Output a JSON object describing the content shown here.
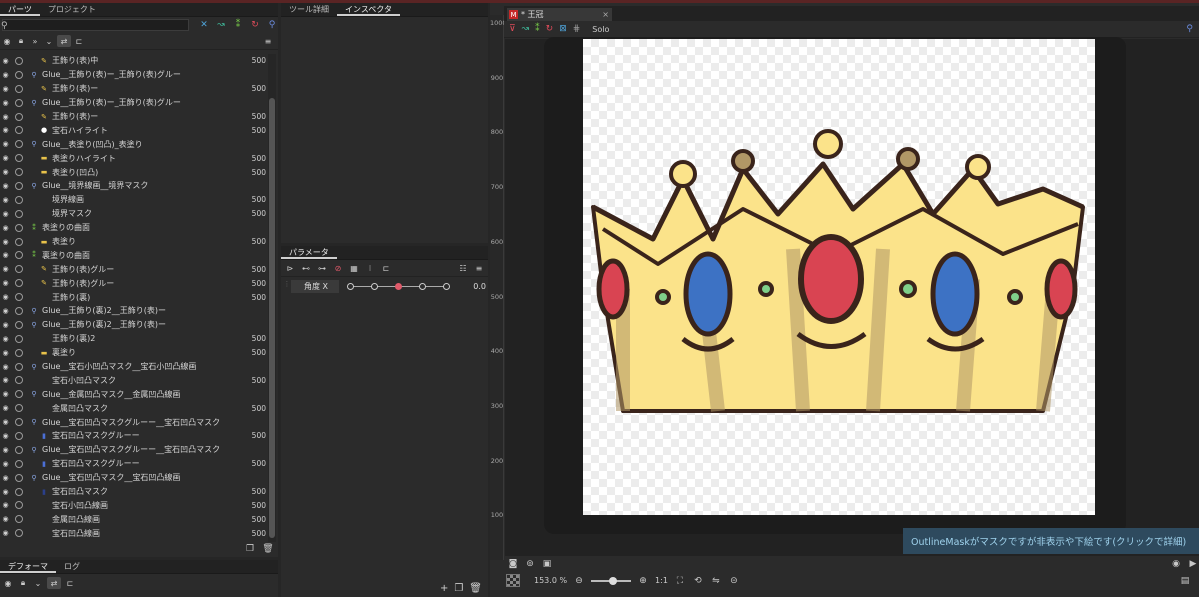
{
  "left_panel": {
    "tabs": [
      "パーツ",
      "プロジェクト"
    ],
    "search": {
      "value": ""
    },
    "layers": [
      {
        "name": "王飾り(表)中",
        "value": "500",
        "indent": 1,
        "type": "art"
      },
      {
        "name": "Glue__王飾り(表)ー_王飾り(表)グルー",
        "value": "",
        "indent": 0,
        "type": "glue"
      },
      {
        "name": "王飾り(表)ー",
        "value": "500",
        "indent": 1,
        "type": "art"
      },
      {
        "name": "Glue__王飾り(表)ー_王飾り(表)グルー",
        "value": "",
        "indent": 0,
        "type": "glue"
      },
      {
        "name": "王飾り(表)ー",
        "value": "500",
        "indent": 1,
        "type": "art"
      },
      {
        "name": "宝石ハイライト",
        "value": "500",
        "indent": 1,
        "type": "white"
      },
      {
        "name": "Glue__表塗り(凹凸)_表塗り",
        "value": "",
        "indent": 0,
        "type": "glue"
      },
      {
        "name": "表塗りハイライト",
        "value": "500",
        "indent": 1,
        "type": "mesh"
      },
      {
        "name": "表塗り(凹凸)",
        "value": "500",
        "indent": 1,
        "type": "mesh"
      },
      {
        "name": "Glue__境界線画__境界マスク",
        "value": "",
        "indent": 0,
        "type": "glue"
      },
      {
        "name": "境界線画",
        "value": "500",
        "indent": 1,
        "type": "none"
      },
      {
        "name": "境界マスク",
        "value": "500",
        "indent": 1,
        "type": "none"
      },
      {
        "name": "表塗りの曲面",
        "value": "",
        "indent": 0,
        "type": "green"
      },
      {
        "name": "表塗り",
        "value": "500",
        "indent": 1,
        "type": "mesh"
      },
      {
        "name": "裏塗りの曲面",
        "value": "",
        "indent": 0,
        "type": "green"
      },
      {
        "name": "王飾り(表)グルー",
        "value": "500",
        "indent": 1,
        "type": "art"
      },
      {
        "name": "王飾り(表)グルー",
        "value": "500",
        "indent": 1,
        "type": "art"
      },
      {
        "name": "王飾り(裏)",
        "value": "500",
        "indent": 1,
        "type": "none"
      },
      {
        "name": "Glue__王飾り(裏)2__王飾り(表)ー",
        "value": "",
        "indent": 0,
        "type": "glue"
      },
      {
        "name": "Glue__王飾り(裏)2__王飾り(表)ー",
        "value": "",
        "indent": 0,
        "type": "glue"
      },
      {
        "name": "王飾り(裏)2",
        "value": "500",
        "indent": 1,
        "type": "none"
      },
      {
        "name": "裏塗り",
        "value": "500",
        "indent": 1,
        "type": "mesh"
      },
      {
        "name": "Glue__宝石小凹凸マスク__宝石小凹凸線画",
        "value": "",
        "indent": 0,
        "type": "glue"
      },
      {
        "name": "宝石小凹凸マスク",
        "value": "500",
        "indent": 1,
        "type": "none"
      },
      {
        "name": "Glue__金属凹凸マスク__金属凹凸線画",
        "value": "",
        "indent": 0,
        "type": "glue"
      },
      {
        "name": "金属凹凸マスク",
        "value": "500",
        "indent": 1,
        "type": "none"
      },
      {
        "name": "Glue__宝石凹凸マスクグルーー__宝石凹凸マスク",
        "value": "",
        "indent": 0,
        "type": "glue"
      },
      {
        "name": "宝石凹凸マスクグルーー",
        "value": "500",
        "indent": 1,
        "type": "blue"
      },
      {
        "name": "Glue__宝石凹凸マスクグルーー__宝石凹凸マスク",
        "value": "",
        "indent": 0,
        "type": "glue"
      },
      {
        "name": "宝石凹凸マスクグルーー",
        "value": "500",
        "indent": 1,
        "type": "blue"
      },
      {
        "name": "Glue__宝石凹凸マスク__宝石凹凸線画",
        "value": "",
        "indent": 0,
        "type": "glue"
      },
      {
        "name": "宝石凹凸マスク",
        "value": "500",
        "indent": 1,
        "type": "darkblue"
      },
      {
        "name": "宝石小凹凸線画",
        "value": "500",
        "indent": 1,
        "type": "none"
      },
      {
        "name": "金属凹凸線画",
        "value": "500",
        "indent": 1,
        "type": "none"
      },
      {
        "name": "宝石凹凸線画",
        "value": "500",
        "indent": 1,
        "type": "none"
      }
    ]
  },
  "deformer_panel": {
    "tabs": [
      "デフォーマ",
      "ログ"
    ]
  },
  "middle_top": {
    "tabs": [
      "ツール詳細",
      "インスペクタ"
    ]
  },
  "parameter_panel": {
    "tabs": [
      "パラメータ"
    ],
    "params": [
      {
        "name": "角度 X",
        "value": "0.0",
        "knots": [
          -30,
          -15,
          0,
          15,
          30
        ],
        "current": 0,
        "min": -30,
        "max": 30
      }
    ]
  },
  "document": {
    "tab_title": "* 王冠",
    "tab_close": "×",
    "solo_label": "Solo",
    "ruler_labels": [
      "1000",
      "900",
      "800",
      "700",
      "600",
      "500",
      "400",
      "300",
      "200",
      "100"
    ],
    "toast": "OutlineMaskがマスクですが非表示や下絵です(クリックで詳細)",
    "zoom_level": "153.0 %",
    "ratio_label": "1:1",
    "colors": {
      "accent_red": "#c62828",
      "toast_bg": "#2e4a5e",
      "toast_text": "#9fd2ec"
    }
  }
}
